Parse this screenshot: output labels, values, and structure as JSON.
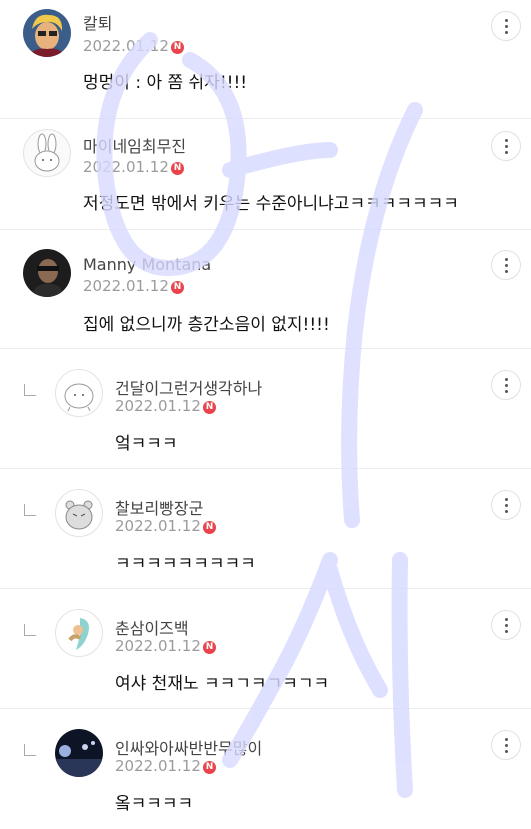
{
  "colors": {
    "new_badge": "#e8444a",
    "divider": "#ececec",
    "watermark": "#d7d9ff"
  },
  "comments": [
    {
      "author": "칼퇴",
      "date": "2022.01.12",
      "new_badge": "N",
      "text": "멍멍이 : 아 쫌 쉬자!!!!",
      "is_reply": false,
      "avatar_icon": "cartoon-man-avatar-icon"
    },
    {
      "author": "마이네임최무진",
      "date": "2022.01.12",
      "new_badge": "N",
      "text": "저정도면 밖에서 키우는 수준아니냐고ㅋㅋㅋㅋㅋㅋㅋ",
      "is_reply": false,
      "avatar_icon": "bunny-avatar-icon"
    },
    {
      "author": "Manny Montana",
      "date": "2022.01.12",
      "new_badge": "N",
      "text": "집에 없으니까 층간소음이 없지!!!!",
      "is_reply": false,
      "avatar_icon": "photo-avatar-icon"
    },
    {
      "author": "건달이그런거생각하나",
      "date": "2022.01.12",
      "new_badge": "N",
      "text": "엌ㅋㅋㅋ",
      "is_reply": true,
      "avatar_icon": "blob-avatar-icon"
    },
    {
      "author": "찰보리빵장군",
      "date": "2022.01.12",
      "new_badge": "N",
      "text": "ㅋㅋㅋㅋㅋㅋㅋㅋㅋ",
      "is_reply": true,
      "avatar_icon": "bear-avatar-icon"
    },
    {
      "author": "춘삼이즈백",
      "date": "2022.01.12",
      "new_badge": "N",
      "text": "여샤 천재노 ㅋㅋㄱㅋㄱㅋㄱㅋ",
      "is_reply": true,
      "avatar_icon": "character-avatar-icon"
    },
    {
      "author": "인싸와아싸반반무많이",
      "date": "2022.01.12",
      "new_badge": "N",
      "text": "옼ㅋㅋㅋㅋ",
      "is_reply": true,
      "avatar_icon": "night-photo-avatar-icon"
    }
  ]
}
